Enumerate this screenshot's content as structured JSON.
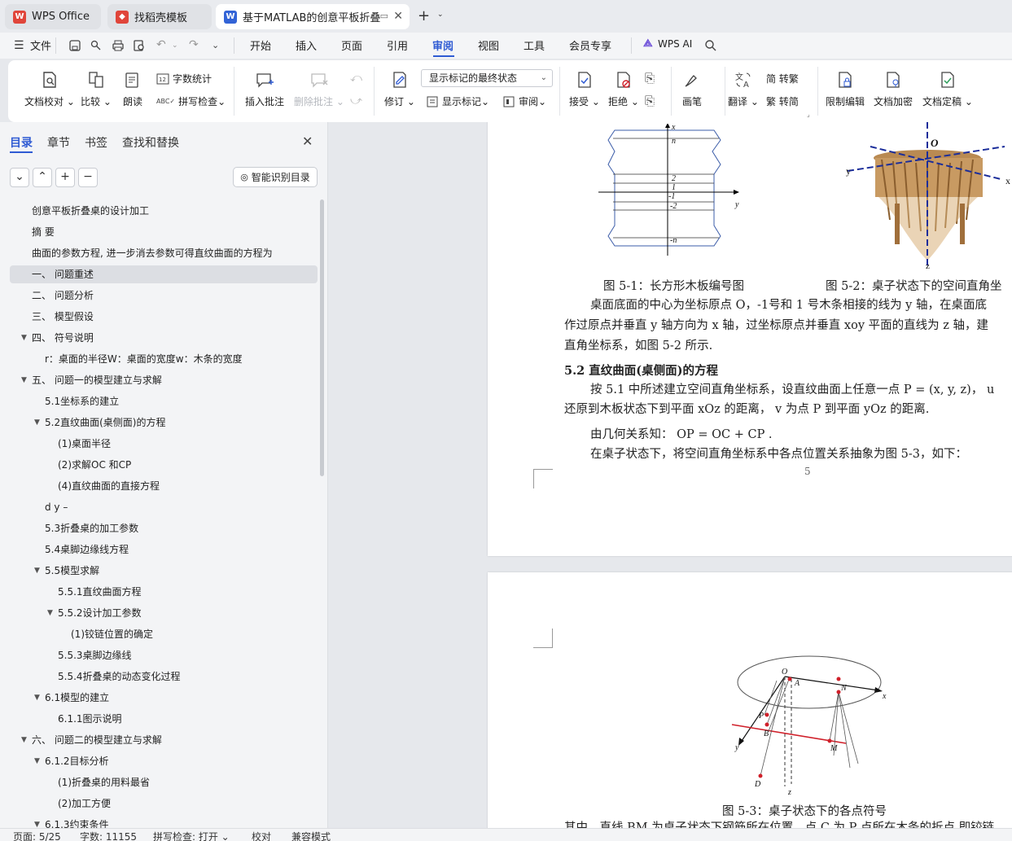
{
  "tabs": [
    {
      "label": "WPS Office"
    },
    {
      "label": "找稻壳模板"
    },
    {
      "label": "基于MATLAB的创意平板折叠"
    }
  ],
  "menu": {
    "file": "文件",
    "items": [
      "开始",
      "插入",
      "页面",
      "引用",
      "审阅",
      "视图",
      "工具",
      "会员专享"
    ],
    "active": "审阅",
    "ai": "WPS AI"
  },
  "ribbon": {
    "proofread": "文档校对",
    "compare": "比较",
    "read_aloud": "朗读",
    "word_count": "字数统计",
    "spell_check": "拼写检查",
    "insert_comment": "插入批注",
    "delete_comment": "删除批注",
    "track_changes": "修订",
    "markup_select": "显示标记的最终状态",
    "show_markup": "显示标记",
    "review": "审阅",
    "accept": "接受",
    "reject": "拒绝",
    "pen": "画笔",
    "translate": "翻译",
    "to_traditional": "简 转繁",
    "to_simplified": "繁 转简",
    "restrict_edit": "限制编辑",
    "encrypt": "文档加密",
    "finalize": "文档定稿"
  },
  "panel": {
    "tabs": [
      "目录",
      "章节",
      "书签",
      "查找和替换"
    ],
    "active_tab": "目录",
    "smart_button": "智能识别目录",
    "toc": [
      {
        "text": "创意平板折叠桌的设计加工",
        "level": 1,
        "caret": ""
      },
      {
        "text": "摘 要",
        "level": 1,
        "caret": ""
      },
      {
        "text": "曲面的参数方程, 进一步消去参数可得直纹曲面的方程为",
        "level": 1,
        "caret": ""
      },
      {
        "text": "一、 问题重述",
        "level": 1,
        "caret": "",
        "selected": true
      },
      {
        "text": "二、 问题分析",
        "level": 1,
        "caret": ""
      },
      {
        "text": "三、 模型假设",
        "level": 1,
        "caret": ""
      },
      {
        "text": "四、 符号说明",
        "level": 1,
        "caret": "▼"
      },
      {
        "text": "r：桌面的半径W：桌面的宽度w：木条的宽度",
        "level": 2,
        "caret": ""
      },
      {
        "text": "五、 问题一的模型建立与求解",
        "level": 1,
        "caret": "▼"
      },
      {
        "text": "5.1坐标系的建立",
        "level": 2,
        "caret": ""
      },
      {
        "text": "5.2直纹曲面(桌侧面)的方程",
        "level": 2,
        "caret": "▼"
      },
      {
        "text": "(1)桌面半径",
        "level": 3,
        "caret": ""
      },
      {
        "text": "(2)求解OC 和CP",
        "level": 3,
        "caret": ""
      },
      {
        "text": "(4)直纹曲面的直接方程",
        "level": 3,
        "caret": ""
      },
      {
        "text": "d y –",
        "level": 2,
        "caret": ""
      },
      {
        "text": "5.3折叠桌的加工参数",
        "level": 2,
        "caret": ""
      },
      {
        "text": "5.4桌脚边缘线方程",
        "level": 2,
        "caret": ""
      },
      {
        "text": "5.5模型求解",
        "level": 2,
        "caret": "▼"
      },
      {
        "text": "5.5.1直纹曲面方程",
        "level": 3,
        "caret": ""
      },
      {
        "text": "5.5.2设计加工参数",
        "level": 3,
        "caret": "▼"
      },
      {
        "text": "(1)铰链位置的确定",
        "level": 4,
        "caret": ""
      },
      {
        "text": "5.5.3桌脚边缘线",
        "level": 3,
        "caret": ""
      },
      {
        "text": "5.5.4折叠桌的动态变化过程",
        "level": 3,
        "caret": ""
      },
      {
        "text": "6.1模型的建立",
        "level": 2,
        "caret": "▼"
      },
      {
        "text": "6.1.1图示说明",
        "level": 3,
        "caret": ""
      },
      {
        "text": "六、 问题二的模型建立与求解",
        "level": 1,
        "caret": "▼"
      },
      {
        "text": "6.1.2目标分析",
        "level": 2,
        "caret": "▼"
      },
      {
        "text": "(1)折叠桌的用料最省",
        "level": 3,
        "caret": ""
      },
      {
        "text": "(2)加工方便",
        "level": 3,
        "caret": ""
      },
      {
        "text": "6.1.3约束条件",
        "level": 2,
        "caret": "▼"
      }
    ]
  },
  "document": {
    "fig1": {
      "labels": [
        "x",
        "n",
        "2",
        "1",
        "-1",
        "-2",
        "y",
        "-n"
      ]
    },
    "fig2": {
      "labels": [
        "O",
        "y",
        "x",
        "z"
      ]
    },
    "caption1": "图 5-1：长方形木板编号图",
    "caption2": "图 5-2：桌子状态下的空间直角坐",
    "p1_l1": "桌面底面的中心为坐标原点 O，-1号和 1 号木条相接的线为 y 轴，在桌面底",
    "p1_l2": "作过原点并垂直  y 轴方向为  x 轴，过坐标原点并垂直  xoy 平面的直线为  z 轴，建",
    "p1_l3": "直角坐标系，如图  5-2 所示.",
    "heading": "5.2  直纹曲面(桌侧面)的方程",
    "p2_l1": "按 5.1 中所述建立空间直角坐标系，设直纹曲面上任意一点  P = (x, y, z)，  u",
    "p2_l2": "还原到木板状态下到平面  xOz 的距离，   v 为点  P 到平面  yOz 的距离.",
    "p3": "由几何关系知：   OP = OC + CP .",
    "p4": "在桌子状态下，将空间直角坐标系中各点位置关系抽象为图  5-3，如下：",
    "page_number": "5",
    "fig3": {
      "labels": [
        "O",
        "A",
        "N",
        "x",
        "P",
        "B",
        "M",
        "y",
        "D",
        "z"
      ]
    },
    "caption3": "图  5-3：桌子状态下的各点符号",
    "p5": "其中，直线  BM 为桌子状态下钢筋所在位置，点 C 为  P 点所在木条的折点,即铰链"
  },
  "status": {
    "page": "页面: 5/25",
    "words": "字数: 11155",
    "spell": "拼写检查: 打开",
    "proof": "校对",
    "compat": "兼容模式"
  },
  "colors": {
    "accent": "#2f5bd3",
    "wps_red": "#e0453a",
    "doc_blue": "#3263d6",
    "red_line": "#d0202a"
  }
}
